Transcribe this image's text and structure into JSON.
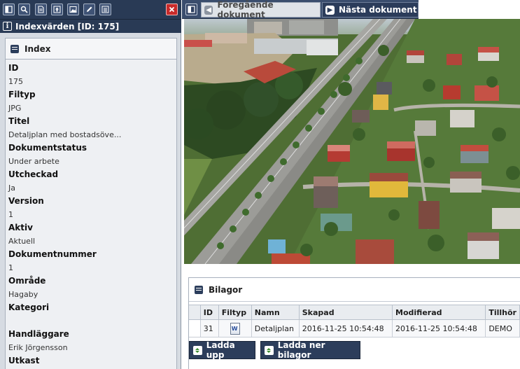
{
  "left_panel": {
    "toolbar_icons": [
      "window-icon",
      "search-icon",
      "document-icon",
      "upload-icon",
      "image-icon",
      "edit-icon",
      "list-icon",
      "close-icon"
    ],
    "header_title": "Indexvärden [ID: 175]",
    "index_title": "Index",
    "fields": [
      {
        "label": "ID",
        "value": "175"
      },
      {
        "label": "Filtyp",
        "value": "JPG"
      },
      {
        "label": "Titel",
        "value": "Detaljplan med bostadsöve..."
      },
      {
        "label": "Dokumentstatus",
        "value": "Under arbete"
      },
      {
        "label": "Utcheckad",
        "value": "Ja"
      },
      {
        "label": "Version",
        "value": "1"
      },
      {
        "label": "Aktiv",
        "value": "Aktuell"
      },
      {
        "label": "Dokumentnummer",
        "value": "1"
      },
      {
        "label": "Område",
        "value": "Hagaby"
      },
      {
        "label": "Kategori",
        "value": ""
      },
      {
        "label": "Handläggare",
        "value": "Erik Jörgensson"
      },
      {
        "label": "Utkast",
        "value": ""
      }
    ]
  },
  "nav": {
    "prev_label": "Föregående dokument",
    "next_label": "Nästa dokument"
  },
  "attachments": {
    "title": "Bilagor",
    "columns": [
      "ID",
      "Filtyp",
      "Namn",
      "Skapad",
      "Modifierad",
      "Tillhör"
    ],
    "rows": [
      {
        "id": "31",
        "filetype": "word-file-icon",
        "name": "Detaljplan",
        "created": "2016-11-25 10:54:48",
        "modified": "2016-11-25 10:54:48",
        "owner": "DEMO"
      }
    ],
    "upload_label": "Ladda upp",
    "download_label": "Ladda ner bilagor"
  },
  "colors": {
    "dark_navy": "#293a55",
    "panel_bg": "#d6dbe2",
    "close_red": "#c92a2a"
  }
}
